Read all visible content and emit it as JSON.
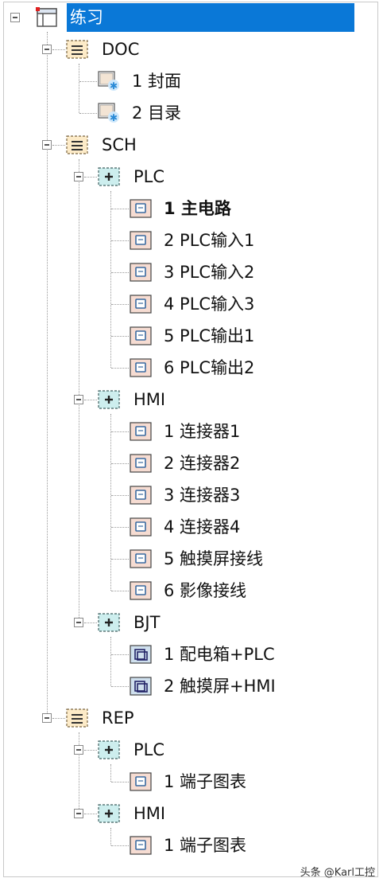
{
  "tree": {
    "root": {
      "label": "练习",
      "selected": true
    },
    "doc": {
      "label": "DOC",
      "items": [
        "1 封面",
        "2 目录"
      ]
    },
    "sch": {
      "label": "SCH",
      "plc": {
        "label": "PLC",
        "items": [
          "1 主电路",
          "2 PLC输入1",
          "3 PLC输入2",
          "4 PLC输入3",
          "5 PLC输出1",
          "6 PLC输出2"
        ],
        "bold_index": 0
      },
      "hmi": {
        "label": "HMI",
        "items": [
          "1 连接器1",
          "2 连接器2",
          "3 连接器3",
          "4 连接器4",
          "5 触摸屏接线",
          "6 影像接线"
        ]
      },
      "bjt": {
        "label": "BJT",
        "items": [
          "1 配电箱+PLC",
          "2 触摸屏+HMI"
        ]
      }
    },
    "rep": {
      "label": "REP",
      "plc": {
        "label": "PLC",
        "items": [
          "1 端子图表"
        ]
      },
      "hmi": {
        "label": "HMI",
        "items": [
          "1 端子图表"
        ]
      }
    }
  },
  "watermark": "头条 @Karl工控",
  "colors": {
    "selection": "#0a78d7"
  }
}
